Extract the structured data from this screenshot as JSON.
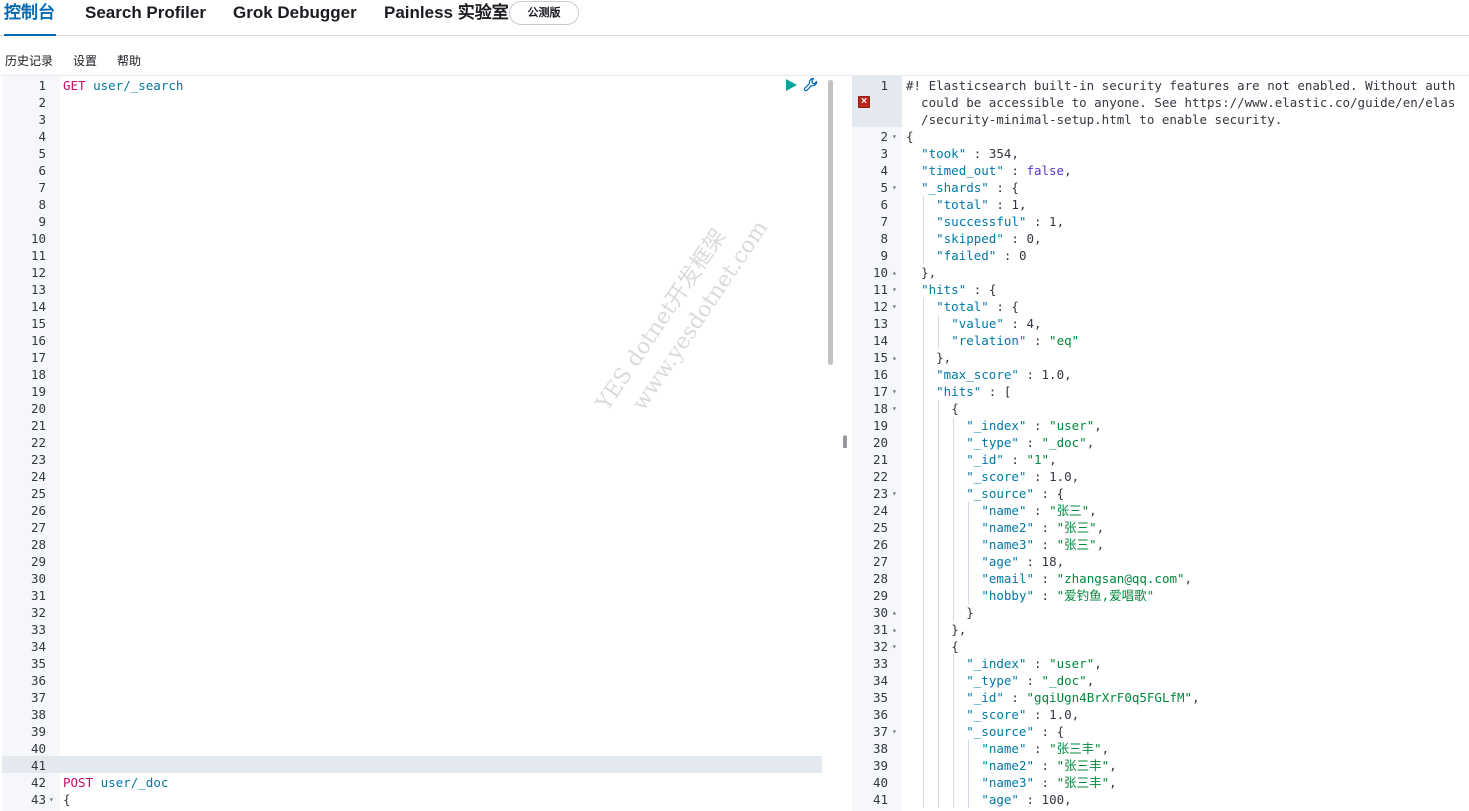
{
  "tabs": [
    {
      "label": "控制台",
      "active": true
    },
    {
      "label": "Search Profiler",
      "active": false
    },
    {
      "label": "Grok Debugger",
      "active": false
    },
    {
      "label": "Painless 实验室",
      "active": false
    }
  ],
  "beta_badge": "公测版",
  "subnav": [
    "历史记录",
    "设置",
    "帮助"
  ],
  "request_editor": {
    "lines": [
      {
        "n": "1",
        "text": "GET user/_search"
      },
      {
        "n": "41",
        "text": ""
      },
      {
        "n": "42",
        "text": "POST user/_doc"
      },
      {
        "n": "43",
        "text": "{"
      }
    ]
  },
  "response": {
    "warning_lines": [
      "#! Elasticsearch built-in security features are not enabled. Without auth",
      "  could be accessible to anyone. See https://www.elastic.co/guide/en/elas",
      "  /security-minimal-setup.html to enable security."
    ],
    "lines": [
      {
        "n": "2",
        "t": "{"
      },
      {
        "n": "3",
        "t": "  \"took\" : 354,"
      },
      {
        "n": "4",
        "t": "  \"timed_out\" : false,"
      },
      {
        "n": "5",
        "t": "  \"_shards\" : {"
      },
      {
        "n": "6",
        "t": "    \"total\" : 1,"
      },
      {
        "n": "7",
        "t": "    \"successful\" : 1,"
      },
      {
        "n": "8",
        "t": "    \"skipped\" : 0,"
      },
      {
        "n": "9",
        "t": "    \"failed\" : 0"
      },
      {
        "n": "10",
        "t": "  },"
      },
      {
        "n": "11",
        "t": "  \"hits\" : {"
      },
      {
        "n": "12",
        "t": "    \"total\" : {"
      },
      {
        "n": "13",
        "t": "      \"value\" : 4,"
      },
      {
        "n": "14",
        "t": "      \"relation\" : \"eq\""
      },
      {
        "n": "15",
        "t": "    },"
      },
      {
        "n": "16",
        "t": "    \"max_score\" : 1.0,"
      },
      {
        "n": "17",
        "t": "    \"hits\" : ["
      },
      {
        "n": "18",
        "t": "      {"
      },
      {
        "n": "19",
        "t": "        \"_index\" : \"user\","
      },
      {
        "n": "20",
        "t": "        \"_type\" : \"_doc\","
      },
      {
        "n": "21",
        "t": "        \"_id\" : \"1\","
      },
      {
        "n": "22",
        "t": "        \"_score\" : 1.0,"
      },
      {
        "n": "23",
        "t": "        \"_source\" : {"
      },
      {
        "n": "24",
        "t": "          \"name\" : \"张三\","
      },
      {
        "n": "25",
        "t": "          \"name2\" : \"张三\","
      },
      {
        "n": "26",
        "t": "          \"name3\" : \"张三\","
      },
      {
        "n": "27",
        "t": "          \"age\" : 18,"
      },
      {
        "n": "28",
        "t": "          \"email\" : \"zhangsan@qq.com\","
      },
      {
        "n": "29",
        "t": "          \"hobby\" : \"爱钓鱼,爱唱歌\""
      },
      {
        "n": "30",
        "t": "        }"
      },
      {
        "n": "31",
        "t": "      },"
      },
      {
        "n": "32",
        "t": "      {"
      },
      {
        "n": "33",
        "t": "        \"_index\" : \"user\","
      },
      {
        "n": "34",
        "t": "        \"_type\" : \"_doc\","
      },
      {
        "n": "35",
        "t": "        \"_id\" : \"gqiUgn4BrXrF0q5FGLfM\","
      },
      {
        "n": "36",
        "t": "        \"_score\" : 1.0,"
      },
      {
        "n": "37",
        "t": "        \"_source\" : {"
      },
      {
        "n": "38",
        "t": "          \"name\" : \"张三丰\","
      },
      {
        "n": "39",
        "t": "          \"name2\" : \"张三丰\","
      },
      {
        "n": "40",
        "t": "          \"name3\" : \"张三丰\","
      },
      {
        "n": "41",
        "t": "          \"age\" : 100,"
      }
    ]
  },
  "watermark": [
    "YES dotnet开发框架",
    "www.yesdotnet.com"
  ],
  "icons": {
    "run": "play-icon",
    "settings": "wrench-icon",
    "error": "error-icon"
  }
}
